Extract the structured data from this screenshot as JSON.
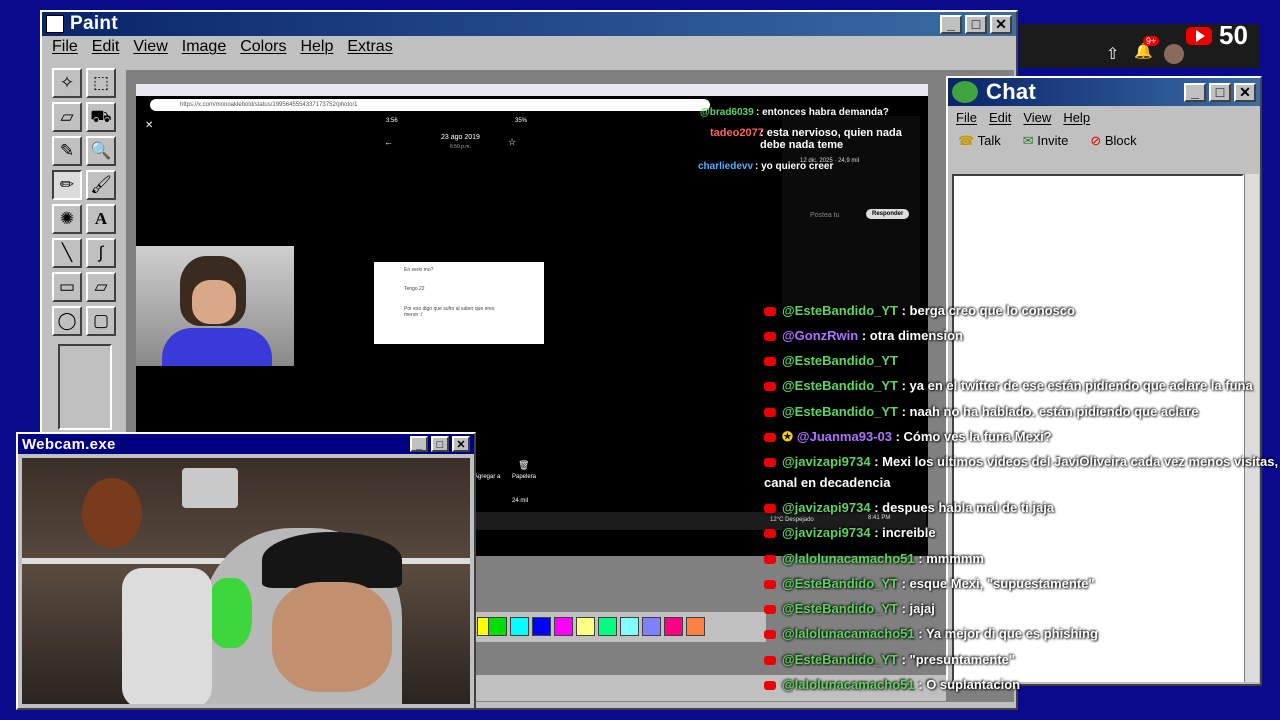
{
  "paint": {
    "title": "Paint",
    "menu": [
      "File",
      "Edit",
      "View",
      "Image",
      "Colors",
      "Help",
      "Extras"
    ],
    "palette": [
      "#ffff00",
      "#00e000",
      "#00ffff",
      "#0000ff",
      "#ff00ff",
      "#ffff80",
      "#00ff80",
      "#80ffff",
      "#8080ff",
      "#ff0080",
      "#ff8040"
    ]
  },
  "stream_overlay": {
    "viewer_count": "50",
    "notif_badge": "9+"
  },
  "browser": {
    "url": "https://x.com/monoaklebold/status/1995645554337173752/photo/1",
    "phone_time": "3:56",
    "phone_battery": "35%",
    "phone_date": "23 ago 2019",
    "phone_hour": "6:50 p.m.",
    "messages": [
      "En serio mo?",
      "Tengo 22",
      "Por eso digo que sufro al saber que eres menor :/"
    ],
    "tweet_stats": "12 dic. 2025 · 24,9 mil",
    "reply_placeholder": "Postea tu",
    "reply_button": "Responder",
    "bottom_labels": [
      "Agregar a",
      "Papelera"
    ],
    "views": "24 mil"
  },
  "webcam": {
    "title": "Webcam.exe"
  },
  "chat_window": {
    "title": "Chat",
    "menu": [
      "File",
      "Edit",
      "View",
      "Help"
    ],
    "toolbar": [
      "Talk",
      "Invite",
      "Block"
    ]
  },
  "top_chat": [
    {
      "user": "@brad6039",
      "text": ": entonces habra demanda?"
    },
    {
      "user": "tadeo2077",
      "text": ": esta nervioso, quien nada debe nada teme"
    },
    {
      "user": "charliedevv",
      "text": ": yo quiero creer"
    }
  ],
  "chat": [
    {
      "user": "@EsteBandido_YT",
      "text": ": berga creo que lo conosco"
    },
    {
      "user": "@GonzRwin",
      "text": ": otra dimension"
    },
    {
      "user": "@EsteBandido_YT",
      "text": ""
    },
    {
      "user": "@EsteBandido_YT",
      "text": ": ya en el twitter de ese están pidiendo que aclare la funa"
    },
    {
      "user": "@EsteBandido_YT",
      "text": ": naah no ha hablado. están pidiendo que aclare"
    },
    {
      "user": "@Juanma93-03",
      "text": ": Cómo ves la funa Mexi?"
    },
    {
      "user": "@javizapi9734",
      "text": ": Mexi los ultimos videos del JaviOliveira cada vez menos visitas,"
    },
    {
      "user": "",
      "text": "canal en decadencia"
    },
    {
      "user": "@javizapi9734",
      "text": ": despues habla mal de ti jaja"
    },
    {
      "user": "@javizapi9734",
      "text": ": increible"
    },
    {
      "user": "@lalolunacamacho51",
      "text": ": mmmmm"
    },
    {
      "user": "@EsteBandido_YT",
      "text": ": esque Mexi, \"supuestamente\""
    },
    {
      "user": "@EsteBandido_YT",
      "text": ": jajaj"
    },
    {
      "user": "@lalolunacamacho51",
      "text": ": Ya mejor di que es phishing"
    },
    {
      "user": "@EsteBandido_YT",
      "text": ": \"presuntamente\""
    },
    {
      "user": "@lalolunacamacho51",
      "text": ": O suplantacion"
    }
  ],
  "taskbar_clock": "8:41 PM",
  "weather": "12°C Despejado"
}
